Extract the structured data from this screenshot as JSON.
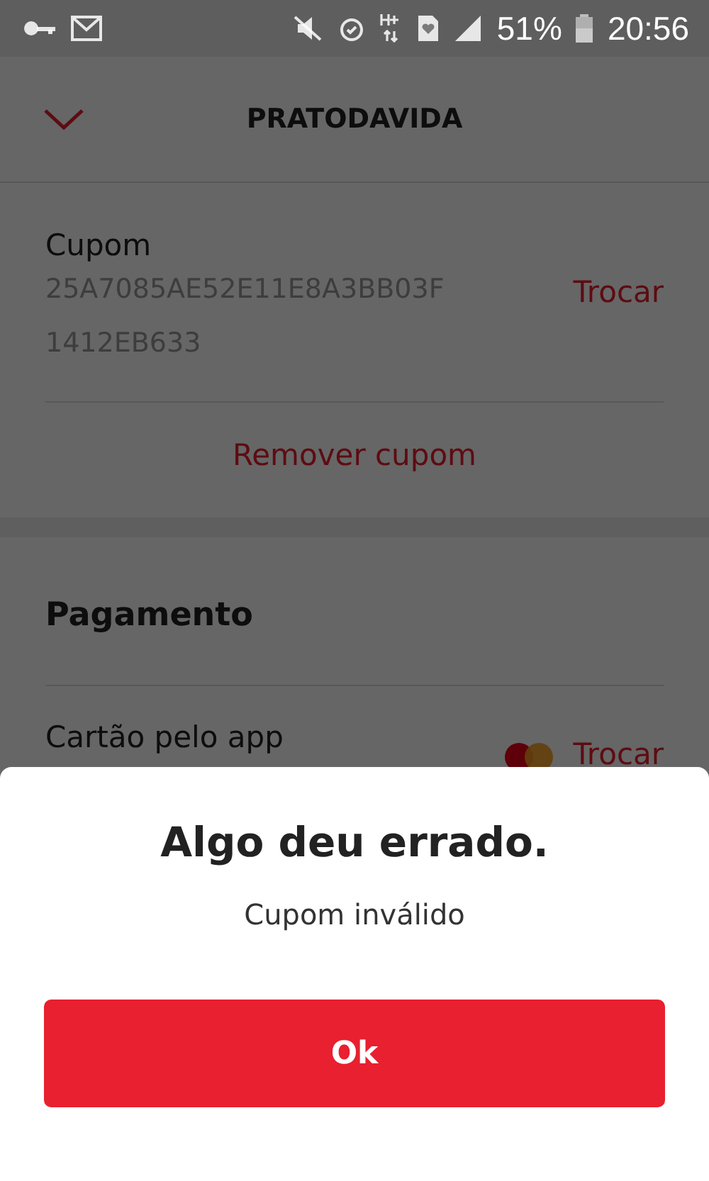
{
  "status_bar": {
    "battery": "51%",
    "time": "20:56"
  },
  "header": {
    "title": "PRATODAVIDA"
  },
  "coupon": {
    "label": "Cupom",
    "code_lines": [
      "25A7085AE52E11E8A3BB03F",
      "1412EB633"
    ],
    "change": "Trocar",
    "remove": "Remover cupom"
  },
  "payment": {
    "title": "Pagamento",
    "method": "Cartão pelo app",
    "change": "Trocar"
  },
  "dialog": {
    "title": "Algo deu errado.",
    "message": "Cupom inválido",
    "button": "Ok"
  }
}
